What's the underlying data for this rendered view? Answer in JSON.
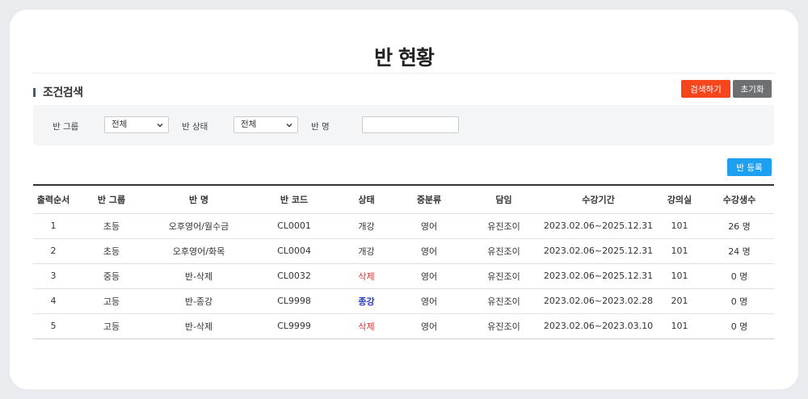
{
  "page": {
    "title": "반 현황"
  },
  "search": {
    "section_title": "조건검색",
    "search_button": "검색하기",
    "reset_button": "초기화",
    "group_label": "반 그룹",
    "group_value": "전체",
    "status_label": "반 상태",
    "status_value": "전체",
    "name_label": "반 명",
    "name_value": ""
  },
  "actions": {
    "register_button": "반 등록"
  },
  "table": {
    "headers": [
      "출력순서",
      "반 그룹",
      "반 명",
      "반 코드",
      "상태",
      "중분류",
      "담임",
      "수강기간",
      "강의실",
      "수강생수"
    ],
    "rows": [
      {
        "order": "1",
        "group": "초등",
        "name": "오후영어/월수금",
        "code": "CL0001",
        "status": "개강",
        "category": "영어",
        "teacher": "유진조이",
        "period": "2023.02.06~2025.12.31",
        "room": "101",
        "students": "26 명"
      },
      {
        "order": "2",
        "group": "초등",
        "name": "오후영어/화목",
        "code": "CL0004",
        "status": "개강",
        "category": "영어",
        "teacher": "유진조이",
        "period": "2023.02.06~2025.12.31",
        "room": "101",
        "students": "24 명"
      },
      {
        "order": "3",
        "group": "중등",
        "name": "반-삭제",
        "code": "CL0032",
        "status": "삭제",
        "category": "영어",
        "teacher": "유진조이",
        "period": "2023.02.06~2025.12.31",
        "room": "101",
        "students": "0 명"
      },
      {
        "order": "4",
        "group": "고등",
        "name": "반-종강",
        "code": "CL9998",
        "status": "종강",
        "category": "영어",
        "teacher": "유진조이",
        "period": "2023.02.06~2023.02.28",
        "room": "201",
        "students": "0 명"
      },
      {
        "order": "5",
        "group": "고등",
        "name": "반-삭제",
        "code": "CL9999",
        "status": "삭제",
        "category": "영어",
        "teacher": "유진조이",
        "period": "2023.02.06~2023.03.10",
        "room": "101",
        "students": "0 명"
      }
    ]
  },
  "colors": {
    "search_button": "#f4451d",
    "reset_button": "#6d6f70",
    "register_button": "#1ea0f0",
    "status_deleted": "#e03030",
    "status_closed": "#2b3bb8"
  },
  "icons": {
    "select_arrow": "chevron-down-icon",
    "section_marker": "section-bar"
  }
}
